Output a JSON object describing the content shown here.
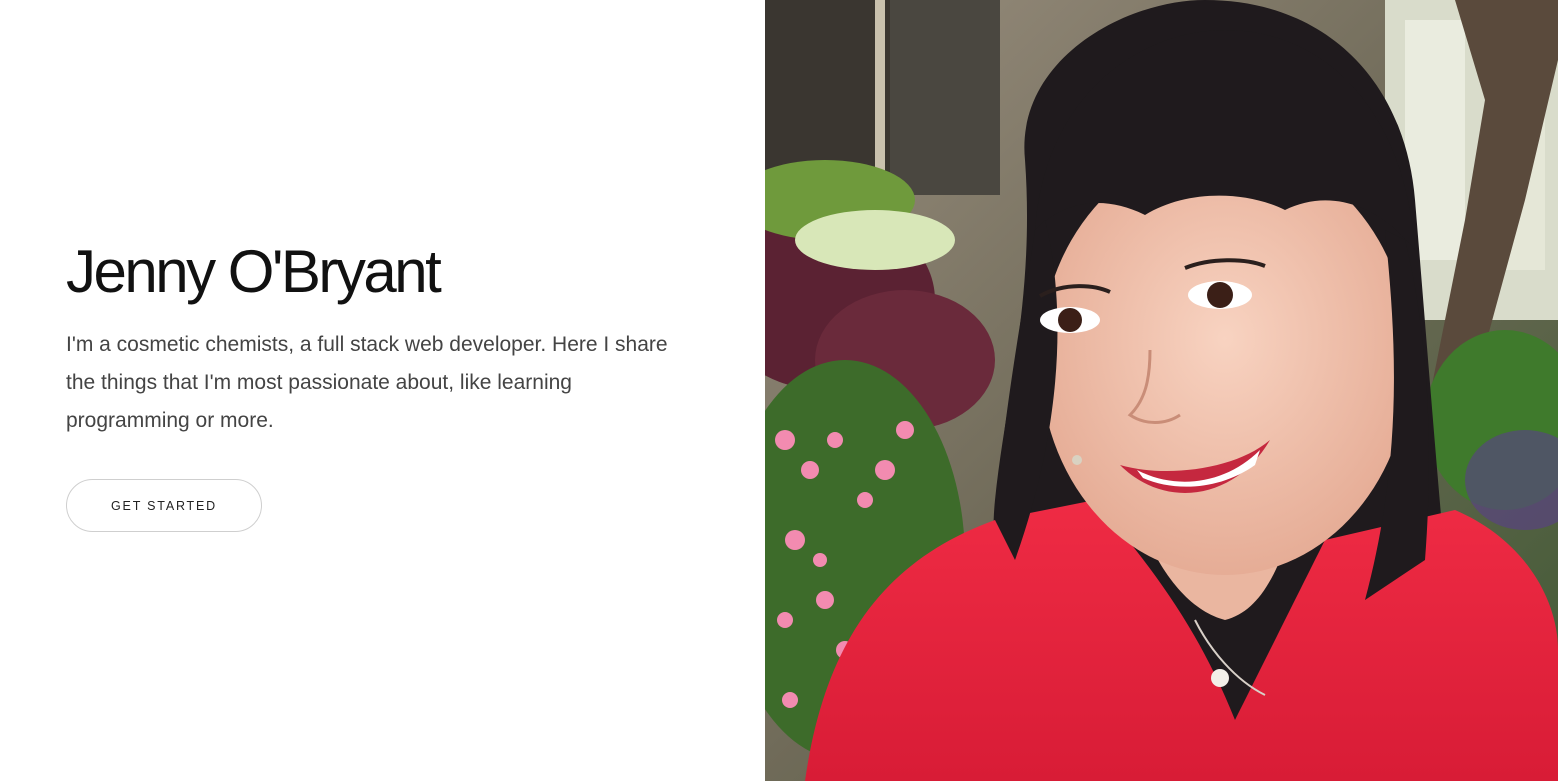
{
  "hero": {
    "name": "Jenny O'Bryant",
    "bio": "I'm a cosmetic chemists, a full stack web developer. Here I share the things that I'm most passionate about, like learning programming or more.",
    "cta_label": "GET STARTED"
  },
  "photo": {
    "alt": "portrait photo",
    "shirt_color": "#e8233e",
    "hair_color": "#1f1a1d",
    "skin_color": "#f2c2ad",
    "foliage_color": "#4f7d3a",
    "flower_color": "#f28bb0"
  }
}
